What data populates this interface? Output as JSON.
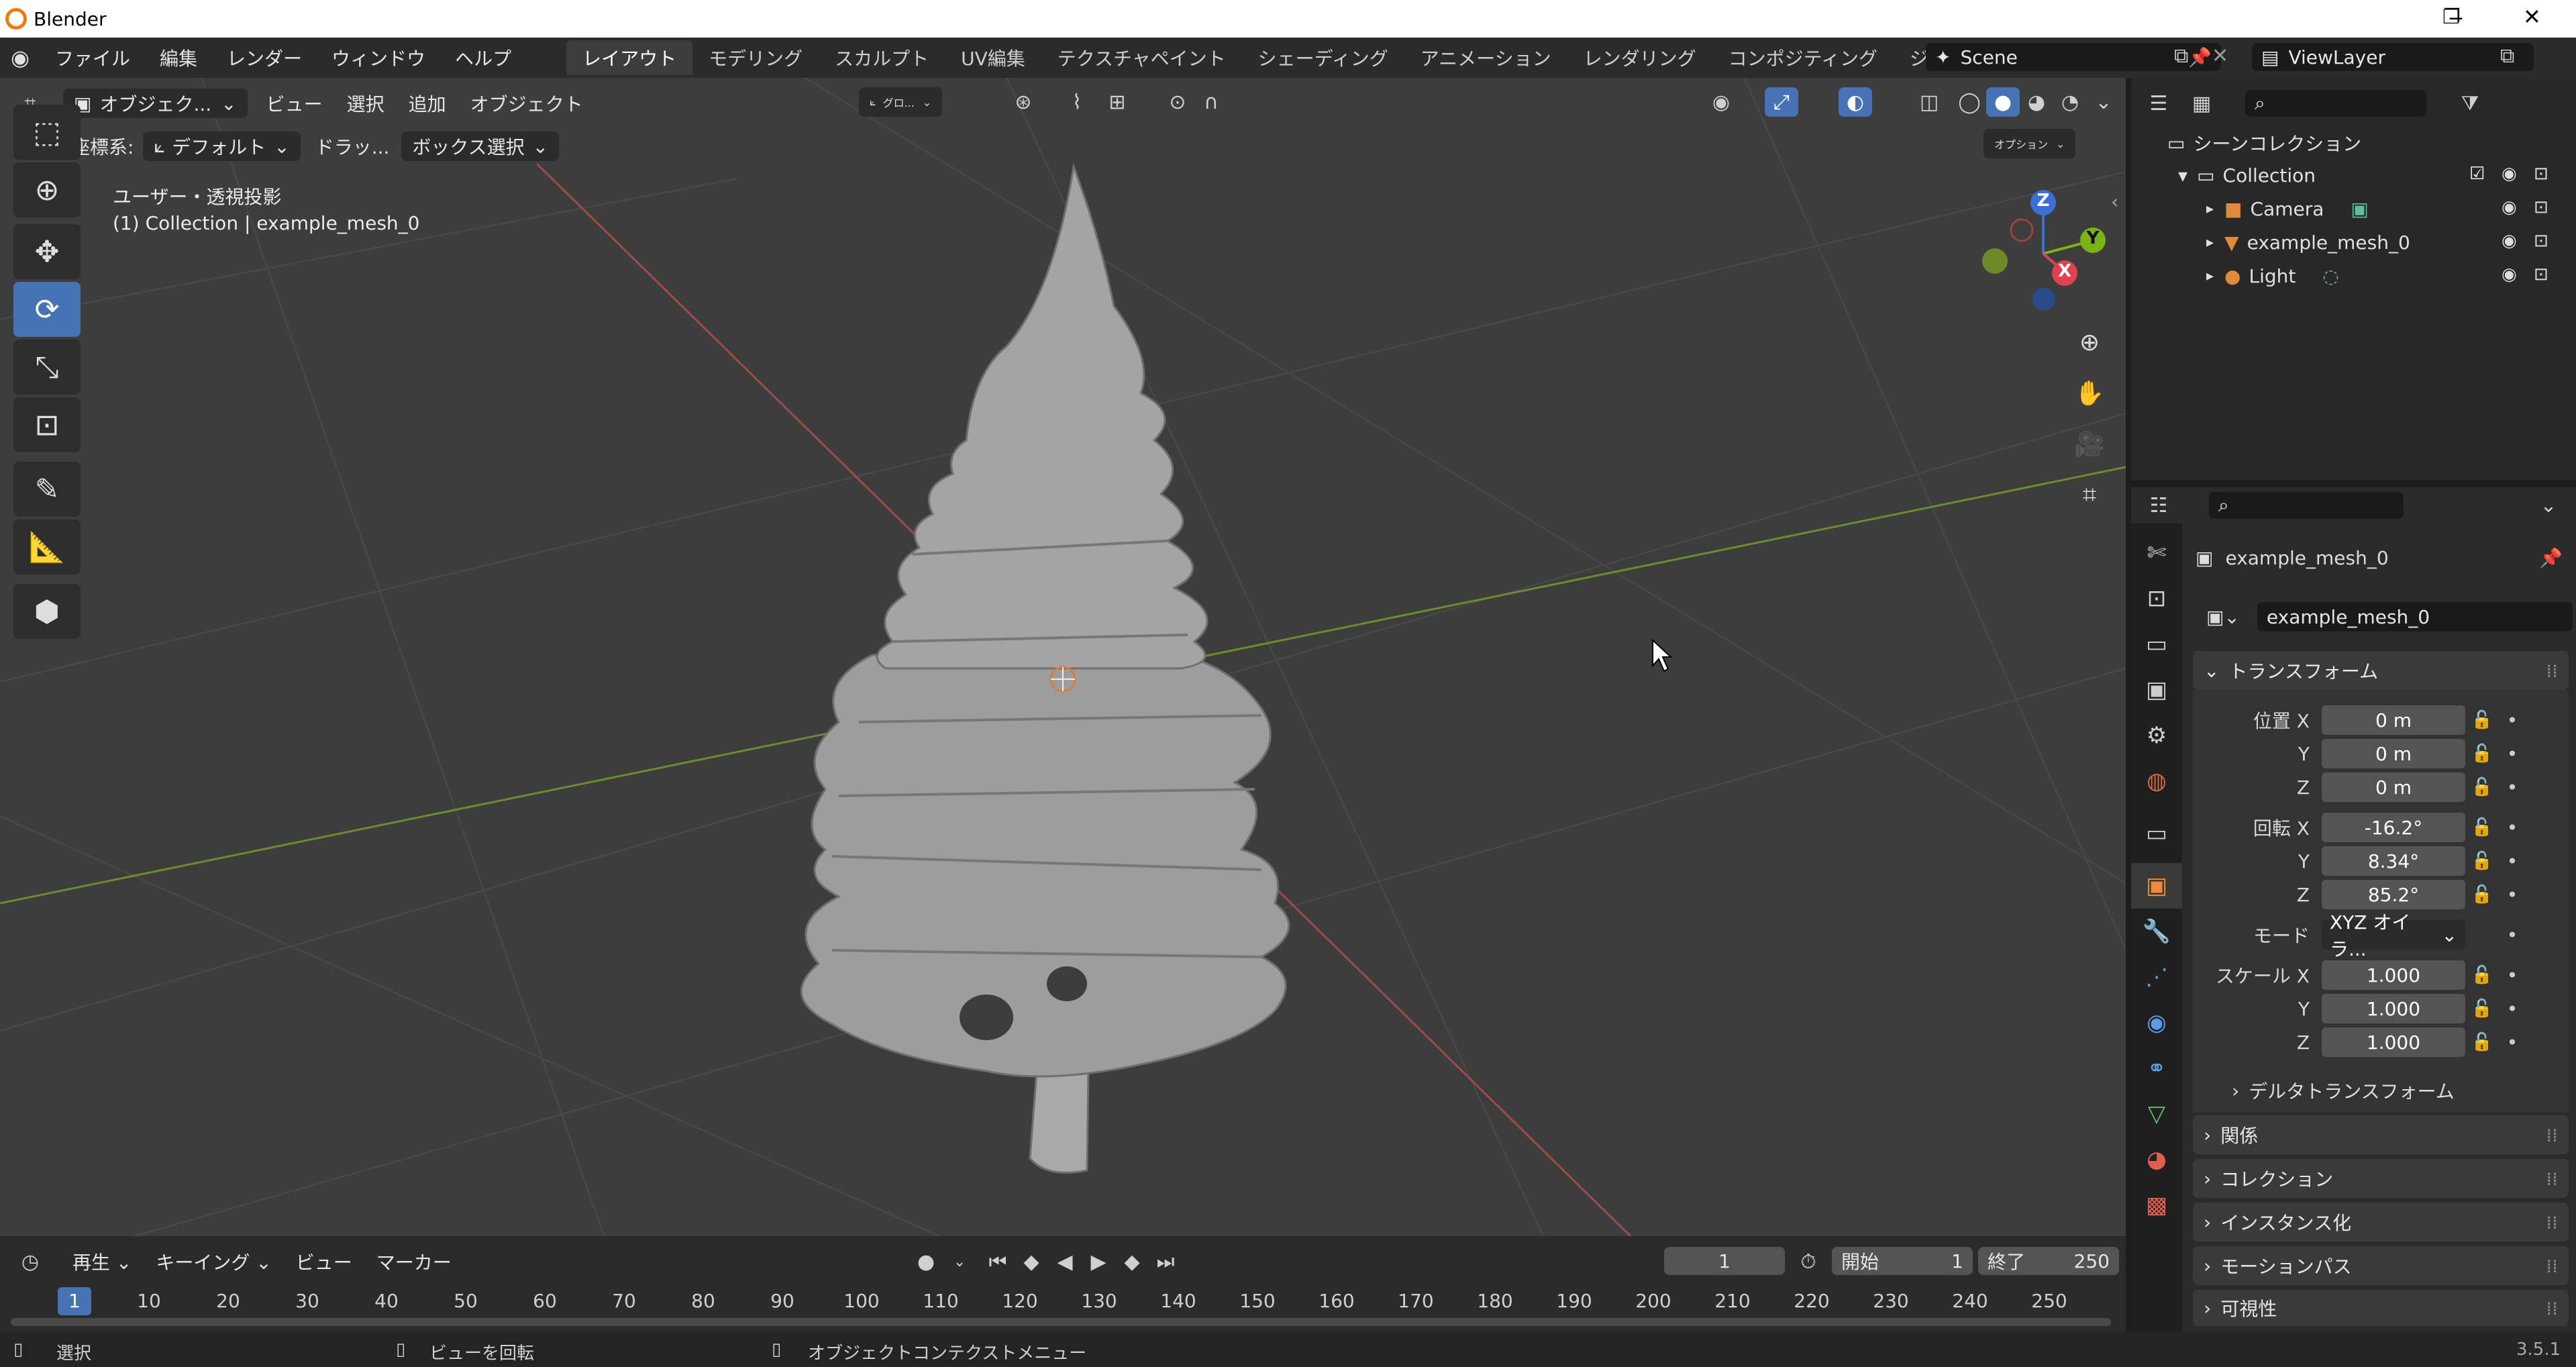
{
  "window": {
    "title": "Blender",
    "minimize": "─",
    "maximize": "❐",
    "close": "✕"
  },
  "menus": [
    "ファイル",
    "編集",
    "レンダー",
    "ウィンドウ",
    "ヘルプ"
  ],
  "workspaces": [
    "レイアウト",
    "モデリング",
    "スカルプト",
    "UV編集",
    "テクスチャペイント",
    "シェーディング",
    "アニメーション",
    "レンダリング",
    "コンポジティング",
    "ジオメト"
  ],
  "scene": "Scene",
  "view_layer": "ViewLayer",
  "viewport": {
    "mode": "オブジェク...",
    "menus": [
      "ビュー",
      "選択",
      "追加",
      "オブジェクト"
    ],
    "transform_orientation": "グロ...",
    "coord_label": "座標系:",
    "coord_value": "デフォルト",
    "drag_label": "ドラッ...",
    "drag_value": "ボックス選択",
    "options": "オプション",
    "view_name": "ユーザー・透視投影",
    "collection_info": "(1) Collection | example_mesh_0",
    "gizmo": {
      "x": "X",
      "y": "Y",
      "z": "Z"
    }
  },
  "outliner": {
    "root": "シーンコレクション",
    "collection": "Collection",
    "items": [
      "Camera",
      "example_mesh_0",
      "Light"
    ]
  },
  "properties": {
    "object_name": "example_mesh_0",
    "data_name": "example_mesh_0",
    "transform_header": "トランスフォーム",
    "location": {
      "label": "位置 X",
      "x": "0 m",
      "y": "0 m",
      "z": "0 m"
    },
    "rotation": {
      "label": "回転 X",
      "x": "-16.2°",
      "y": "8.34°",
      "z": "85.2°"
    },
    "mode": {
      "label": "モード",
      "value": "XYZ オイラ..."
    },
    "scale": {
      "label": "スケール X",
      "x": "1.000",
      "y": "1.000",
      "z": "1.000"
    },
    "axis_y": "Y",
    "axis_z": "Z",
    "delta": "デルタトランスフォーム",
    "panels": [
      "関係",
      "コレクション",
      "インスタンス化",
      "モーションパス",
      "可視性"
    ]
  },
  "timeline": {
    "menus": [
      "再生",
      "キーイング",
      "ビュー",
      "マーカー"
    ],
    "current_frame": "1",
    "start_label": "開始",
    "start": "1",
    "end_label": "終了",
    "end": "250",
    "ticks": [
      "1",
      "10",
      "20",
      "30",
      "40",
      "50",
      "60",
      "70",
      "80",
      "90",
      "100",
      "110",
      "120",
      "130",
      "140",
      "150",
      "160",
      "170",
      "180",
      "190",
      "200",
      "210",
      "220",
      "230",
      "240",
      "250"
    ]
  },
  "statusbar": {
    "select": "選択",
    "rotate": "ビューを回転",
    "context": "オブジェクトコンテクストメニュー",
    "version": "3.5.1"
  }
}
